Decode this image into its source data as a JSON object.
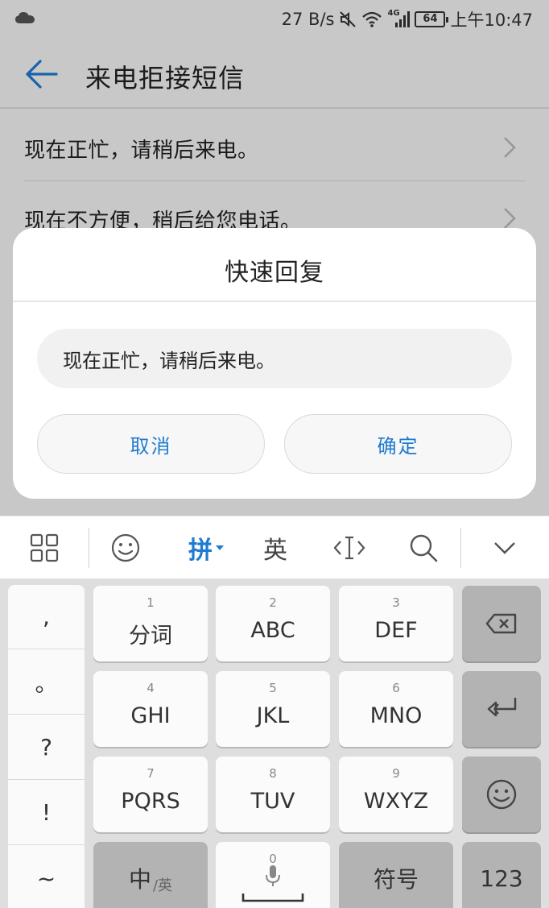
{
  "status_bar": {
    "net_speed": "27 B/s",
    "network": "4G",
    "battery": "64",
    "time": "上午10:47"
  },
  "toolbar": {
    "back_icon": "arrow-left-icon",
    "title": "来电拒接短信"
  },
  "messages": [
    {
      "label": "现在正忙，请稍后来电。"
    },
    {
      "label": "现在不方便，稍后给您电话。"
    }
  ],
  "dialog": {
    "title": "快速回复",
    "input_value": "现在正忙，请稍后来电。",
    "cancel_label": "取消",
    "confirm_label": "确定"
  },
  "ime_bar": {
    "menu_icon": "grid-icon",
    "emoji_icon": "smiley-icon",
    "pinyin_label": "拼",
    "english_label": "英",
    "cursor_icon": "text-cursor-icon",
    "search_icon": "search-icon",
    "collapse_icon": "chevron-down-icon"
  },
  "keyboard": {
    "punctuation": [
      ",",
      "。",
      "?",
      "!",
      "~"
    ],
    "keys": [
      {
        "num": "1",
        "label": "分词"
      },
      {
        "num": "2",
        "label": "ABC"
      },
      {
        "num": "3",
        "label": "DEF"
      },
      {
        "num": "4",
        "label": "GHI"
      },
      {
        "num": "5",
        "label": "JKL"
      },
      {
        "num": "6",
        "label": "MNO"
      },
      {
        "num": "7",
        "label": "PQRS"
      },
      {
        "num": "8",
        "label": "TUV"
      },
      {
        "num": "9",
        "label": "WXYZ"
      }
    ],
    "zh_label": "中",
    "en_sub_label": "/英",
    "space_num": "0",
    "symbol_label": "符号",
    "num_label": "123",
    "backspace_icon": "backspace-icon",
    "enter_icon": "enter-icon",
    "emoji_key_icon": "smiley-icon",
    "mic_icon": "microphone-icon"
  },
  "colors": {
    "accent": "#1e7bd1"
  }
}
